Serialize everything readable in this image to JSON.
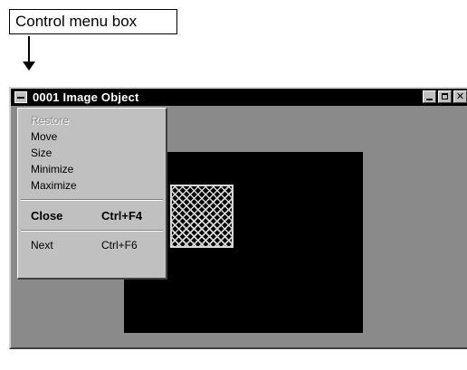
{
  "callout": {
    "label": "Control menu box"
  },
  "window": {
    "title": "0001 Image Object",
    "buttons": [
      "minimize",
      "maximize",
      "close"
    ],
    "close_glyph": "✕"
  },
  "control_menu": {
    "items": [
      {
        "label": "Restore",
        "shortcut": "",
        "enabled": false,
        "bold": false
      },
      {
        "label": "Move",
        "shortcut": "",
        "enabled": true,
        "bold": false
      },
      {
        "label": "Size",
        "shortcut": "",
        "enabled": true,
        "bold": false
      },
      {
        "label": "Minimize",
        "shortcut": "",
        "enabled": true,
        "bold": false
      },
      {
        "label": "Maximize",
        "shortcut": "",
        "enabled": true,
        "bold": false
      },
      {
        "label": "Close",
        "shortcut": "Ctrl+F4",
        "enabled": true,
        "bold": true
      },
      {
        "label": "Next",
        "shortcut": "Ctrl+F6",
        "enabled": true,
        "bold": false
      }
    ]
  },
  "colors": {
    "title_bar": "#000000",
    "client_area": "#8a8a8a",
    "image_background": "#000000",
    "menu_face": "#c0c0c0",
    "disabled_text": "#8a8a8a"
  },
  "icons": {
    "control_box": "control-menu-box-icon",
    "arrow": "arrow-down-icon"
  }
}
